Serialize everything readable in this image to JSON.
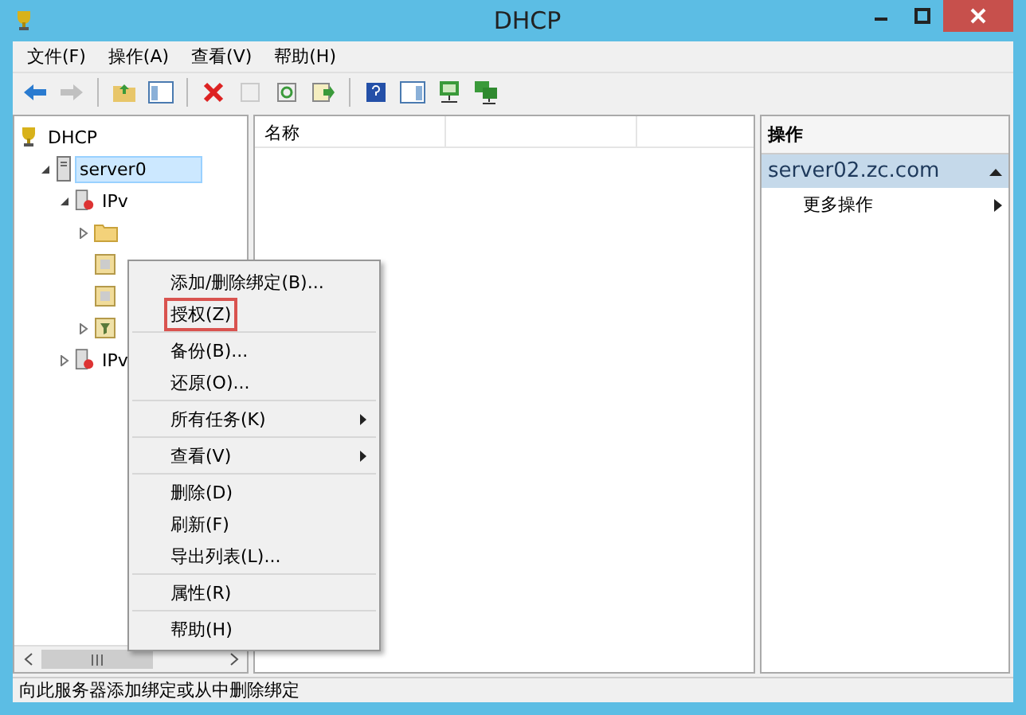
{
  "window": {
    "title": "DHCP"
  },
  "menu_bar": [
    "文件(F)",
    "操作(A)",
    "查看(V)",
    "帮助(H)"
  ],
  "toolbar": [
    {
      "kind": "back",
      "disabled": false
    },
    {
      "kind": "forward",
      "disabled": true
    },
    {
      "kind": "sep"
    },
    {
      "kind": "up",
      "disabled": false
    },
    {
      "kind": "tree",
      "disabled": false
    },
    {
      "kind": "sep"
    },
    {
      "kind": "delete",
      "disabled": false
    },
    {
      "kind": "props",
      "disabled": true
    },
    {
      "kind": "refresh",
      "disabled": false
    },
    {
      "kind": "export",
      "disabled": false
    },
    {
      "kind": "sep"
    },
    {
      "kind": "help",
      "disabled": false
    },
    {
      "kind": "pane",
      "disabled": false
    },
    {
      "kind": "monitor",
      "disabled": false
    },
    {
      "kind": "monitors",
      "disabled": false
    }
  ],
  "tree": [
    {
      "label": "DHCP",
      "kind": "root",
      "children": [
        {
          "label": "server0",
          "kind": "server",
          "expanded": true,
          "selected": true,
          "children": [
            {
              "label": "IPv",
              "kind": "proto",
              "expanded": true,
              "selected": false,
              "children": [
                {
                  "kind": "folder",
                  "expanded": false
                },
                {
                  "kind": "doc"
                },
                {
                  "kind": "doc"
                },
                {
                  "kind": "filter",
                  "expanded": false
                }
              ]
            },
            {
              "label": "IPv",
              "kind": "proto",
              "expanded": false,
              "selected": false
            }
          ]
        }
      ]
    }
  ],
  "list": {
    "columns": [
      "名称"
    ]
  },
  "context_menu": [
    [
      {
        "label": "添加/删除绑定(B)...",
        "highlighted": false
      },
      {
        "label": "授权(Z)",
        "highlighted": true
      }
    ],
    [
      {
        "label": "备份(B)...",
        "highlighted": false
      },
      {
        "label": "还原(O)...",
        "highlighted": false
      }
    ],
    [
      {
        "label": "所有任务(K)",
        "submenu": true,
        "highlighted": false
      }
    ],
    [
      {
        "label": "查看(V)",
        "submenu": true,
        "highlighted": false
      }
    ],
    [
      {
        "label": "删除(D)",
        "highlighted": false
      },
      {
        "label": "刷新(F)",
        "highlighted": false
      },
      {
        "label": "导出列表(L)...",
        "highlighted": false
      }
    ],
    [
      {
        "label": "属性(R)",
        "highlighted": false
      }
    ],
    [
      {
        "label": "帮助(H)",
        "highlighted": false
      }
    ]
  ],
  "actions": {
    "header": "操作",
    "sections": [
      {
        "title": "server02.zc.com",
        "expanded": true,
        "items": [
          {
            "label": "更多操作",
            "submenu": true
          }
        ]
      }
    ]
  },
  "status_bar": "向此服务器添加绑定或从中删除绑定"
}
